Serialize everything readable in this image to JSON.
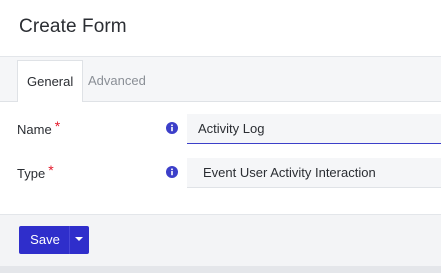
{
  "header": {
    "title": "Create Form"
  },
  "tabs": [
    {
      "label": "General",
      "active": true
    },
    {
      "label": "Advanced",
      "active": false
    }
  ],
  "fields": {
    "name": {
      "label": "Name",
      "required_mark": "*",
      "value": "Activity Log",
      "icon": "info-icon"
    },
    "type": {
      "label": "Type",
      "required_mark": "*",
      "value": "Event User Activity Interaction",
      "icon": "info-icon"
    }
  },
  "footer": {
    "save_label": "Save",
    "menu_icon": "caret-down-icon"
  },
  "colors": {
    "primary": "#2f2ecb",
    "required": "#e4182a",
    "info": "#3c3fc9",
    "focus_border": "#3c3fc9"
  }
}
